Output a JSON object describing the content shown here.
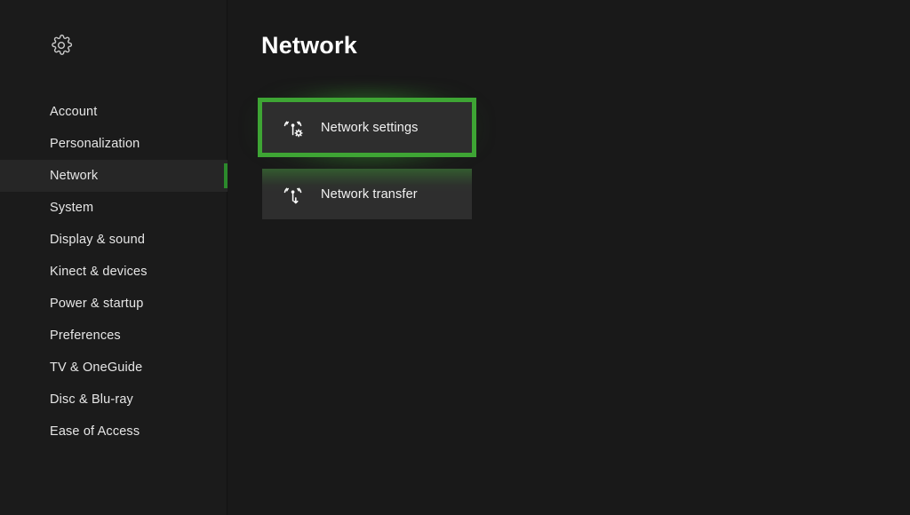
{
  "app": {
    "header_icon": "gear-icon"
  },
  "sidebar": {
    "items": [
      {
        "label": "Account",
        "selected": false
      },
      {
        "label": "Personalization",
        "selected": false
      },
      {
        "label": "Network",
        "selected": true
      },
      {
        "label": "System",
        "selected": false
      },
      {
        "label": "Display & sound",
        "selected": false
      },
      {
        "label": "Kinect & devices",
        "selected": false
      },
      {
        "label": "Power & startup",
        "selected": false
      },
      {
        "label": "Preferences",
        "selected": false
      },
      {
        "label": "TV & OneGuide",
        "selected": false
      },
      {
        "label": "Disc & Blu-ray",
        "selected": false
      },
      {
        "label": "Ease of Access",
        "selected": false
      }
    ]
  },
  "main": {
    "title": "Network",
    "tiles": [
      {
        "label": "Network settings",
        "icon": "network-settings-icon",
        "focused": true
      },
      {
        "label": "Network transfer",
        "icon": "network-transfer-icon",
        "focused": false
      }
    ]
  },
  "colors": {
    "focus_green": "#3ea534",
    "accent_green": "#2c8a2c",
    "sidebar_bg": "#1b1b1b",
    "main_bg": "#191919",
    "tile_bg": "#2e2e2e",
    "selected_row_bg": "#262626",
    "text": "#e6e6e6"
  }
}
